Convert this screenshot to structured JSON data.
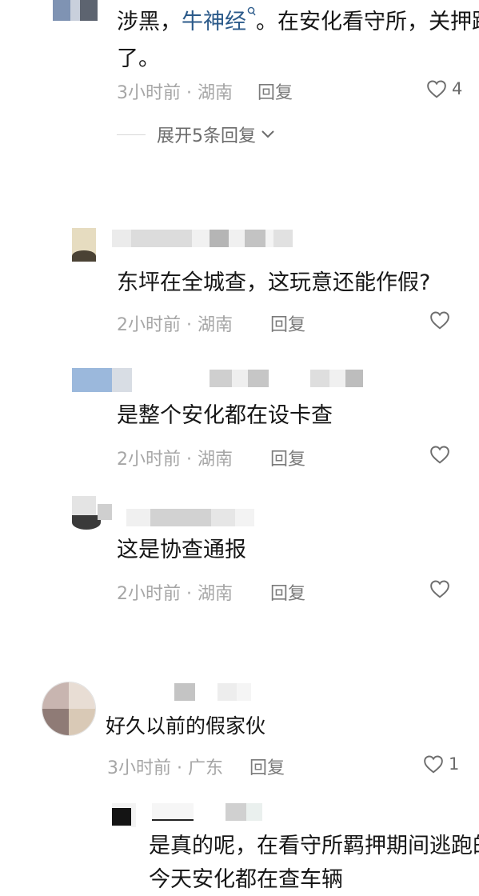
{
  "comments": [
    {
      "id": "c1",
      "text_before": "涉黑，",
      "link_text": "牛神经",
      "text_after": "。在安化看守所，关押跑",
      "text_line2": "了。",
      "time": "3小时前",
      "location": "湖南",
      "reply_label": "回复",
      "likes": "4",
      "expand_label": "展开5条回复"
    },
    {
      "id": "c2",
      "text": "东坪在全城查，这玩意还能作假?",
      "time": "2小时前",
      "location": "湖南",
      "reply_label": "回复"
    },
    {
      "id": "c3",
      "text": "是整个安化都在设卡查",
      "time": "2小时前",
      "location": "湖南",
      "reply_label": "回复"
    },
    {
      "id": "c4",
      "text": "这是协查通报",
      "time": "2小时前",
      "location": "湖南",
      "reply_label": "回复"
    },
    {
      "id": "c5",
      "text": "好久以前的假家伙",
      "time": "3小时前",
      "location": "广东",
      "reply_label": "回复",
      "likes": "1"
    },
    {
      "id": "c6",
      "text_line1": "是真的呢，在看守所羁押期间逃跑的",
      "text_line2": "今天安化都在查车辆"
    }
  ],
  "meta_separator": " · ",
  "icons": {
    "like": "heart-outline-icon",
    "expand": "chevron-down-icon",
    "search": "search-icon"
  }
}
